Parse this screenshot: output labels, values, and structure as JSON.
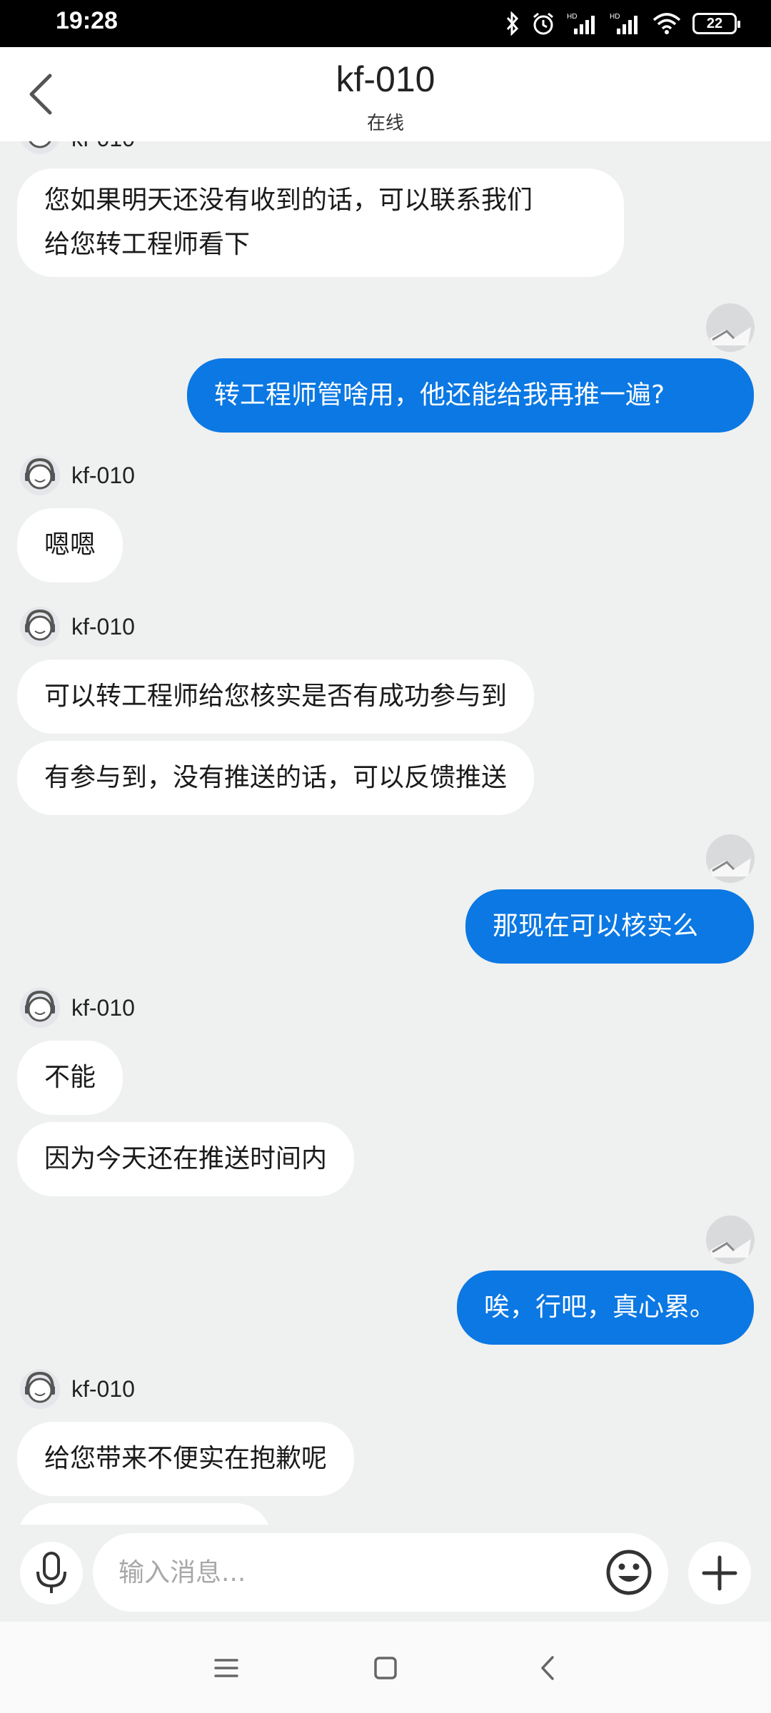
{
  "status_bar": {
    "time": "19:28",
    "battery": "22"
  },
  "header": {
    "title": "kf-010",
    "subtitle": "在线"
  },
  "messages": [
    {
      "from": "agent",
      "sender": "kf-010",
      "bubbles": [
        "您如果明天还没有收到的话，可以联系我们",
        "给您转工程师看下"
      ]
    },
    {
      "from": "me",
      "text": "转工程师管啥用，他还能给我再推一遍?"
    },
    {
      "from": "agent",
      "sender": "kf-010",
      "text": "嗯嗯"
    },
    {
      "from": "agent",
      "sender": "kf-010",
      "texts": [
        "可以转工程师给您核实是否有成功参与到",
        "有参与到，没有推送的话，可以反馈推送"
      ]
    },
    {
      "from": "me",
      "text": "那现在可以核实么"
    },
    {
      "from": "agent",
      "sender": "kf-010",
      "texts": [
        "不能",
        "因为今天还在推送时间内"
      ]
    },
    {
      "from": "me",
      "text": "唉，行吧，真心累。"
    },
    {
      "from": "agent",
      "sender": "kf-010",
      "text": "给您带来不便实在抱歉呢"
    }
  ],
  "input": {
    "placeholder": "输入消息..."
  },
  "icons": {
    "back": "chevron-left-icon",
    "voice": "microphone-icon",
    "emoji": "smiley-icon",
    "plus": "plus-icon",
    "nav": [
      "menu-icon",
      "home-square-icon",
      "back-triangle-icon"
    ]
  },
  "colors": {
    "me_bubble": "#0b78e3",
    "background": "#eff0f0"
  }
}
